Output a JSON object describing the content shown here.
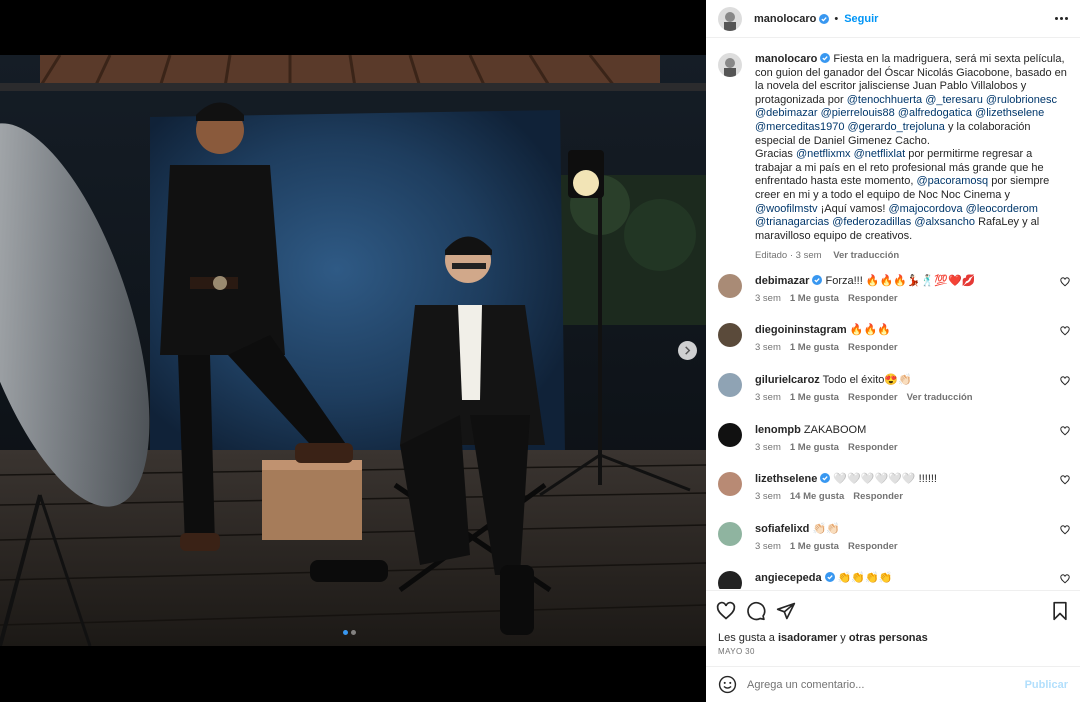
{
  "post": {
    "author": "manolocaro",
    "follow_label": "Seguir",
    "dot": "•",
    "caption": [
      {
        "t": "text",
        "v": "Fiesta en la madriguera, será mi sexta película, con guion del ganador del Óscar Nicolás Giacobone, basado en la novela del escritor jalisciense Juan Pablo Villalobos y protagonizada por "
      },
      {
        "t": "mention",
        "v": "@tenochhuerta"
      },
      {
        "t": "text",
        "v": " "
      },
      {
        "t": "mention",
        "v": "@_teresaru"
      },
      {
        "t": "text",
        "v": " "
      },
      {
        "t": "mention",
        "v": "@rulobrionesc"
      },
      {
        "t": "text",
        "v": " "
      },
      {
        "t": "mention",
        "v": "@debimazar"
      },
      {
        "t": "text",
        "v": " "
      },
      {
        "t": "mention",
        "v": "@pierrelouis88"
      },
      {
        "t": "text",
        "v": " "
      },
      {
        "t": "mention",
        "v": "@alfredogatica"
      },
      {
        "t": "text",
        "v": " "
      },
      {
        "t": "mention",
        "v": "@lizethselene"
      },
      {
        "t": "text",
        "v": " "
      },
      {
        "t": "mention",
        "v": "@merceditas1970"
      },
      {
        "t": "text",
        "v": " "
      },
      {
        "t": "mention",
        "v": "@gerardo_trejoluna"
      },
      {
        "t": "text",
        "v": " y la colaboración especial de Daniel Gimenez Cacho."
      },
      {
        "t": "br"
      },
      {
        "t": "text",
        "v": "Gracias "
      },
      {
        "t": "mention",
        "v": "@netflixmx"
      },
      {
        "t": "text",
        "v": " "
      },
      {
        "t": "mention",
        "v": "@netflixlat"
      },
      {
        "t": "text",
        "v": " por permitirme regresar a trabajar a mi país en el reto profesional más grande que he enfrentado hasta este momento, "
      },
      {
        "t": "mention",
        "v": "@pacoramosq"
      },
      {
        "t": "text",
        "v": " por siempre creer en mi y a todo el equipo de Noc Noc Cinema y "
      },
      {
        "t": "mention",
        "v": "@woofilmstv"
      },
      {
        "t": "text",
        "v": " ¡Aquí vamos! "
      },
      {
        "t": "mention",
        "v": "@majocordova"
      },
      {
        "t": "text",
        "v": " "
      },
      {
        "t": "mention",
        "v": "@leocorderom"
      },
      {
        "t": "text",
        "v": " "
      },
      {
        "t": "mention",
        "v": "@trianagarcias"
      },
      {
        "t": "text",
        "v": " "
      },
      {
        "t": "mention",
        "v": "@federozadillas"
      },
      {
        "t": "text",
        "v": " "
      },
      {
        "t": "mention",
        "v": "@alxsancho"
      },
      {
        "t": "text",
        "v": " RafaLey y al maravilloso equipo de creativos."
      }
    ],
    "caption_meta": {
      "edited": "Editado · 3 sem",
      "translate": "Ver traducción"
    }
  },
  "comments": [
    {
      "user": "debimazar",
      "verified": true,
      "text": "Forza!!! 🔥🔥🔥💃🏻🕺🏻💯❤️💋",
      "time": "3 sem",
      "likes": "1 Me gusta",
      "reply": "Responder",
      "extra": ""
    },
    {
      "user": "diegoininstagram",
      "verified": false,
      "text": "🔥🔥🔥",
      "time": "3 sem",
      "likes": "1 Me gusta",
      "reply": "Responder",
      "extra": ""
    },
    {
      "user": "gilurielcaroz",
      "verified": false,
      "text": "Todo el éxito😍👏🏻",
      "time": "3 sem",
      "likes": "1 Me gusta",
      "reply": "Responder",
      "extra": "Ver traducción"
    },
    {
      "user": "lenompb",
      "verified": false,
      "text": "ZAKABOOM",
      "time": "3 sem",
      "likes": "1 Me gusta",
      "reply": "Responder",
      "extra": ""
    },
    {
      "user": "lizethselene",
      "verified": true,
      "text": "🤍🤍🤍🤍🤍🤍 !!!!!!",
      "time": "3 sem",
      "likes": "14 Me gusta",
      "reply": "Responder",
      "extra": ""
    },
    {
      "user": "sofiafelixd",
      "verified": false,
      "text": "👏🏻👏🏻",
      "time": "3 sem",
      "likes": "1 Me gusta",
      "reply": "Responder",
      "extra": ""
    },
    {
      "user": "angiecepeda",
      "verified": true,
      "text": "👏👏👏👏",
      "time": "",
      "likes": "",
      "reply": "",
      "extra": ""
    }
  ],
  "likes": {
    "prefix": "Les gusta a ",
    "user": "isadoramer",
    "mid": " y ",
    "others": "otras personas"
  },
  "date": "MAYO 30",
  "comment_box": {
    "placeholder": "Agrega un comentario...",
    "publish": "Publicar"
  },
  "colors": {
    "accent": "#0095f6",
    "verified": "#3897f0",
    "mention": "#00376b",
    "backdrop": "#1d3a5c"
  },
  "icons": [
    "more-icon",
    "next-arrow-icon",
    "heart-icon",
    "comment-icon",
    "share-icon",
    "save-icon",
    "emoji-icon",
    "verified-icon"
  ],
  "carousel": {
    "total": 2,
    "current": 1
  }
}
